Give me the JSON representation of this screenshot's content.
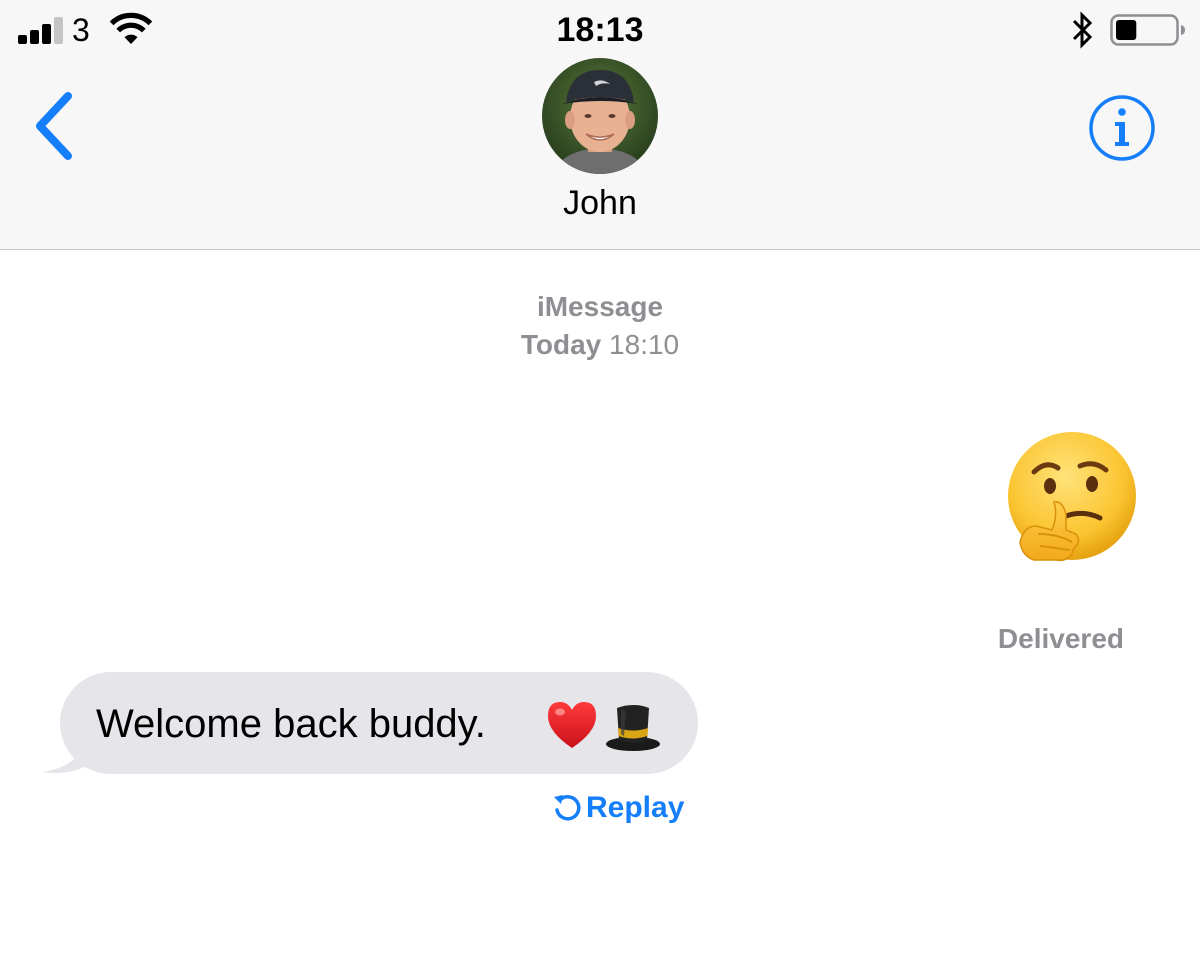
{
  "status_bar": {
    "signal_bars_filled": 3,
    "signal_bars_total": 4,
    "carrier": "3",
    "wifi_icon": "wifi-icon",
    "time": "18:13",
    "bluetooth_icon": "bluetooth-icon",
    "battery_icon": "battery-icon",
    "battery_level": 0.35
  },
  "nav": {
    "back_icon": "chevron-left-icon",
    "contact_name": "John",
    "info_icon": "info-circle-icon"
  },
  "conversation": {
    "service": "iMessage",
    "timestamp_day": "Today",
    "timestamp_time": "18:10",
    "sent_message": {
      "emoji": "🤔",
      "status": "Delivered"
    },
    "received_message": {
      "text": "Welcome back buddy.",
      "emoji": [
        "❤️",
        "🎩"
      ],
      "replay_label": "Replay"
    }
  },
  "colors": {
    "accent": "#147efb",
    "received_bubble": "#e5e5ea",
    "secondary_text": "#8e8e93",
    "header_bg": "#f7f7f7"
  }
}
